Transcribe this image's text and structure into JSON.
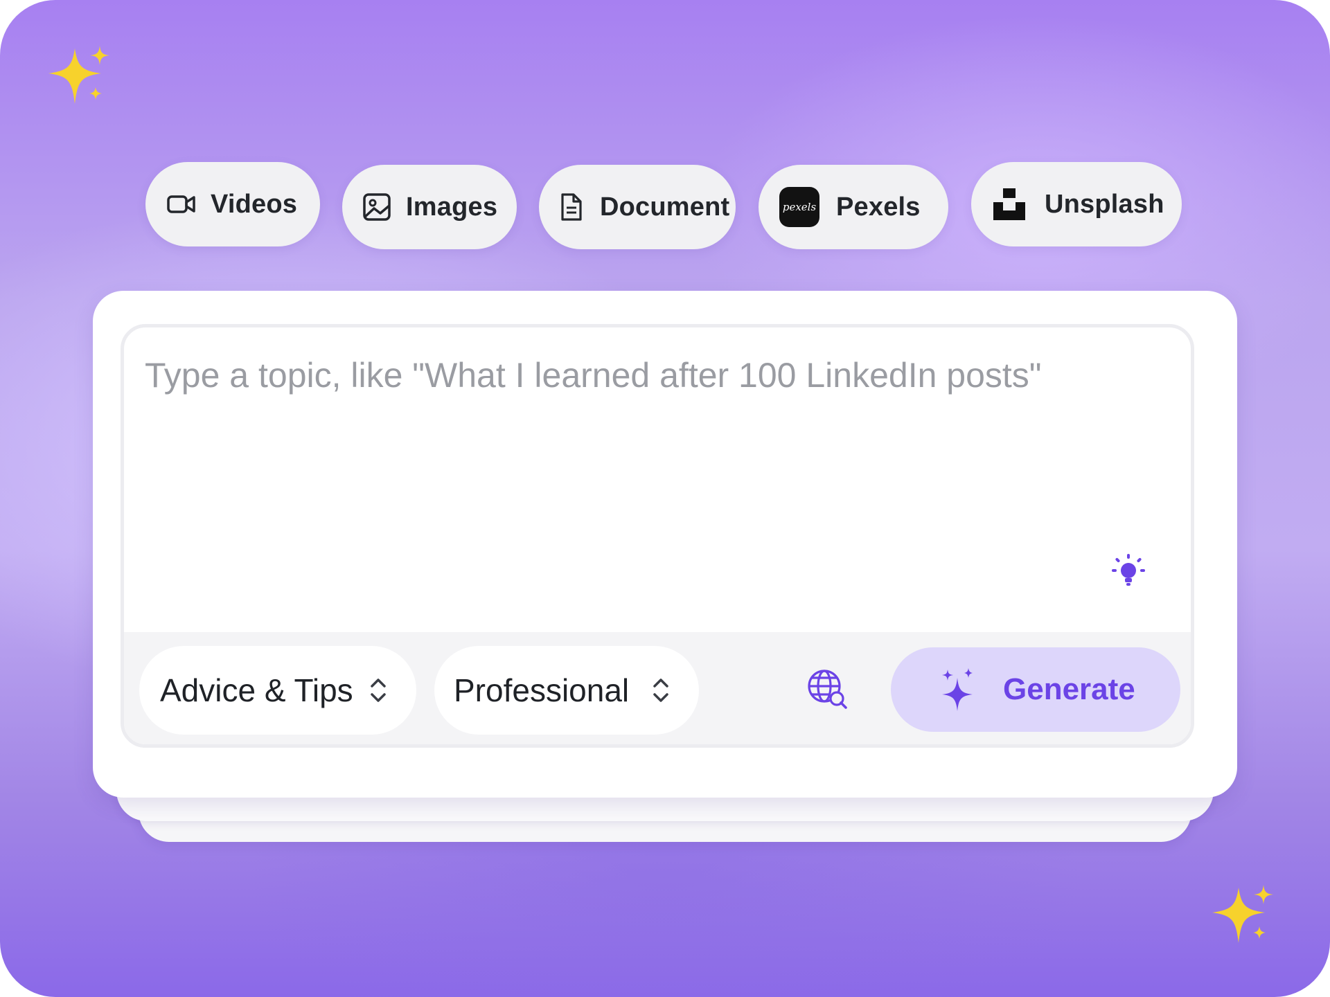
{
  "source_tabs": [
    {
      "label": "Videos",
      "icon": "video-camera-icon"
    },
    {
      "label": "Images",
      "icon": "image-icon"
    },
    {
      "label": "Document",
      "icon": "document-icon"
    },
    {
      "label": "Pexels",
      "icon": "pexels-logo-icon",
      "logo_text": "pexels"
    },
    {
      "label": "Unsplash",
      "icon": "unsplash-logo-icon"
    }
  ],
  "editor": {
    "placeholder": "Type a topic, like \"What I learned after 100 LinkedIn posts\"",
    "value": "",
    "idea_icon": "lightbulb-icon"
  },
  "toolbar": {
    "category": {
      "value": "Advice & Tips",
      "icon": "chevron-updown-icon"
    },
    "tone": {
      "value": "Professional",
      "icon": "chevron-updown-icon"
    },
    "web_search_icon": "globe-search-icon",
    "generate": {
      "label": "Generate",
      "icon": "sparkles-icon"
    }
  },
  "colors": {
    "accent": "#6b43e6",
    "accent_soft": "#ddd6fb",
    "sparkle": "#f7d22c",
    "background_top": "#a780f1",
    "background_bottom": "#8b69e8"
  }
}
